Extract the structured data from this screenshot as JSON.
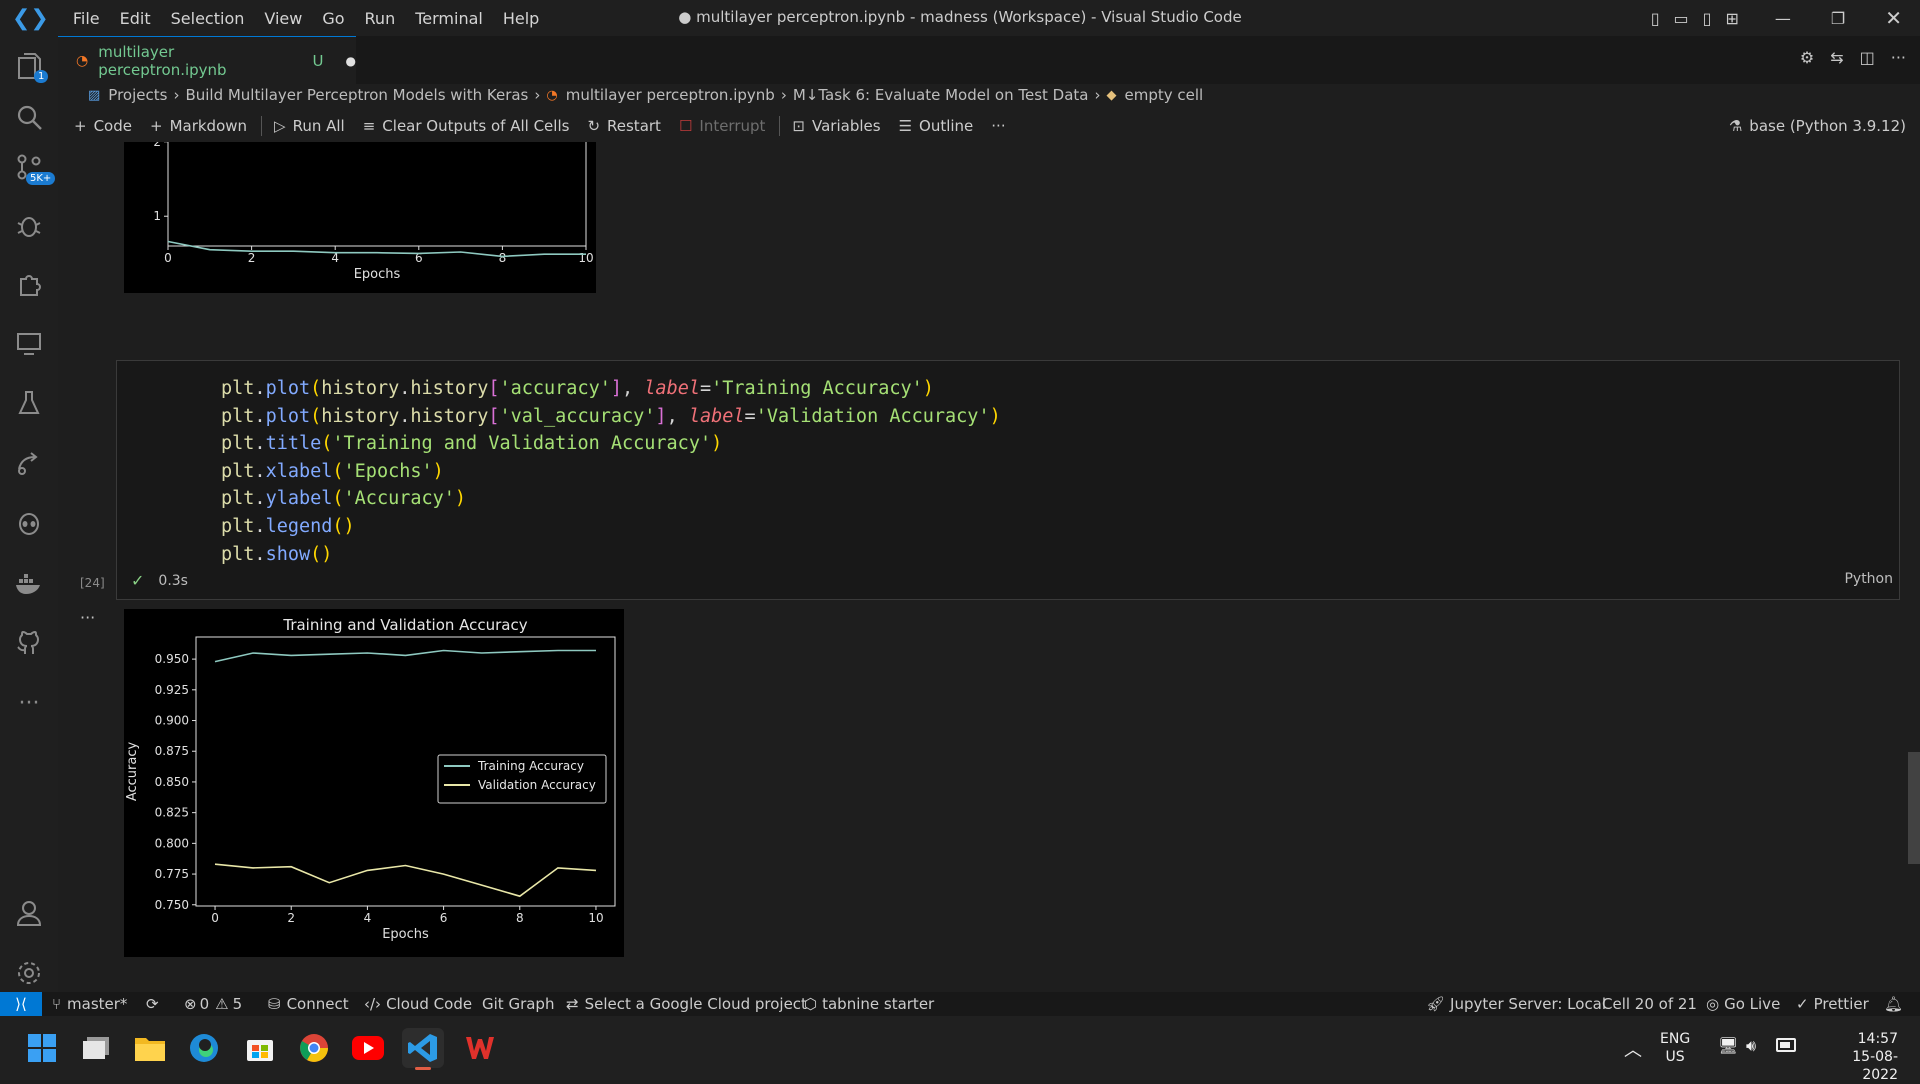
{
  "window": {
    "menu": [
      "File",
      "Edit",
      "Selection",
      "View",
      "Go",
      "Run",
      "Terminal",
      "Help"
    ],
    "title": "● multilayer perceptron.ipynb - madness (Workspace) - Visual Studio Code"
  },
  "activity_bar": {
    "explorer_badge": "1",
    "source_control_badge": "5K+"
  },
  "tab": {
    "label": "multilayer perceptron.ipynb",
    "status": "U"
  },
  "breadcrumb": [
    "Projects",
    "Build Multilayer Perceptron Models with Keras",
    "multilayer perceptron.ipynb",
    "M↓Task 6: Evaluate Model on Test Data",
    "empty cell"
  ],
  "toolbar": {
    "code": "Code",
    "markdown": "Markdown",
    "run_all": "Run All",
    "clear_outputs": "Clear Outputs of All Cells",
    "restart": "Restart",
    "interrupt": "Interrupt",
    "variables": "Variables",
    "outline": "Outline",
    "more": "···",
    "kernel": "base (Python 3.9.12)"
  },
  "cell": {
    "exec_count": "[24]",
    "status_time": "0.3s",
    "language": "Python",
    "more": "···"
  },
  "chart_data": [
    {
      "type": "line",
      "title": "",
      "xlabel": "Epochs",
      "ylabel": "",
      "x_ticks": [
        "0",
        "2",
        "4",
        "6",
        "8",
        "10"
      ],
      "y_ticks": [
        "1",
        "2"
      ],
      "xlim": [
        0,
        10
      ],
      "ylim": [
        0.6,
        2.4
      ],
      "series": [
        {
          "values": [
            0.66,
            0.55,
            0.53,
            0.53,
            0.51,
            0.51,
            0.5,
            0.52,
            0.46,
            0.49,
            0.49
          ],
          "color": "#8ec9c0"
        }
      ]
    },
    {
      "type": "line",
      "title": "Training and Validation Accuracy",
      "xlabel": "Epochs",
      "ylabel": "Accuracy",
      "x": [
        0,
        1,
        2,
        3,
        4,
        5,
        6,
        7,
        8,
        9,
        10
      ],
      "x_ticks": [
        "0",
        "2",
        "4",
        "6",
        "8",
        "10"
      ],
      "y_ticks": [
        "0.750",
        "0.775",
        "0.800",
        "0.825",
        "0.850",
        "0.875",
        "0.900",
        "0.925",
        "0.950"
      ],
      "xlim": [
        -0.5,
        10.5
      ],
      "ylim": [
        0.749,
        0.968
      ],
      "legend_position": "center-right",
      "series": [
        {
          "name": "Training Accuracy",
          "values": [
            0.948,
            0.955,
            0.953,
            0.954,
            0.955,
            0.953,
            0.957,
            0.955,
            0.956,
            0.957,
            0.957
          ],
          "color": "#8ec9c0"
        },
        {
          "name": "Validation Accuracy",
          "values": [
            0.783,
            0.78,
            0.781,
            0.768,
            0.778,
            0.782,
            0.775,
            0.766,
            0.757,
            0.78,
            0.778
          ],
          "color": "#e9e7a8"
        }
      ]
    }
  ],
  "statusbar": {
    "branch": "master*",
    "errors": "0",
    "warnings": "5",
    "connect": "Connect",
    "cloud_code": "Cloud Code",
    "git_graph": "Git Graph",
    "gcp": "Select a Google Cloud project",
    "tabnine": "tabnine starter",
    "jupyter": "Jupyter Server: Local",
    "cell_pos": "Cell 20 of 21",
    "go_live": "Go Live",
    "prettier": "Prettier"
  },
  "taskbar": {
    "lang1": "ENG",
    "lang2": "US",
    "time": "14:57",
    "date": "15-08-2022"
  }
}
